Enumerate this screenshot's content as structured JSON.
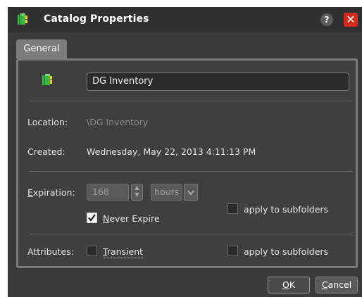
{
  "window": {
    "title": "Catalog Properties",
    "help_label": "?",
    "close_label": "✕"
  },
  "tabs": [
    {
      "label": "General",
      "selected": true
    }
  ],
  "general": {
    "name_value": "DG Inventory",
    "location": {
      "label": "Location:",
      "value": "\\DG Inventory"
    },
    "created": {
      "label": "Created:",
      "value": "Wednesday, May 22, 2013 4:11:13 PM"
    },
    "expiration": {
      "label_prefix": "E",
      "label_rest": "xpiration:",
      "amount": "168",
      "unit": "hours",
      "never_expire_prefix": "N",
      "never_expire_rest": "ever Expire",
      "never_expire_checked": true,
      "apply_label": "apply to subfolders",
      "apply_checked": false
    },
    "attributes": {
      "label": "Attributes:",
      "transient_prefix": "T",
      "transient_rest": "ransient",
      "transient_checked": false,
      "apply_label": "apply to subfolders",
      "apply_checked": false
    }
  },
  "footer": {
    "ok_prefix": "O",
    "ok_rest": "K",
    "cancel_prefix": "C",
    "cancel_rest": "ancel"
  },
  "icons": {
    "catalog": "catalog-book-icon",
    "spinner": "spinner-updown-icon",
    "dropdown": "chevron-down-icon",
    "checkmark": "checkmark-icon"
  },
  "colors": {
    "window_bg": "#3a3a3a",
    "titlebar_bg": "#303030",
    "panel_border": "#7b7b7b",
    "close_red": "#d42b1e",
    "icon_green": "#3fb64a",
    "icon_yellow": "#f2d21b"
  }
}
